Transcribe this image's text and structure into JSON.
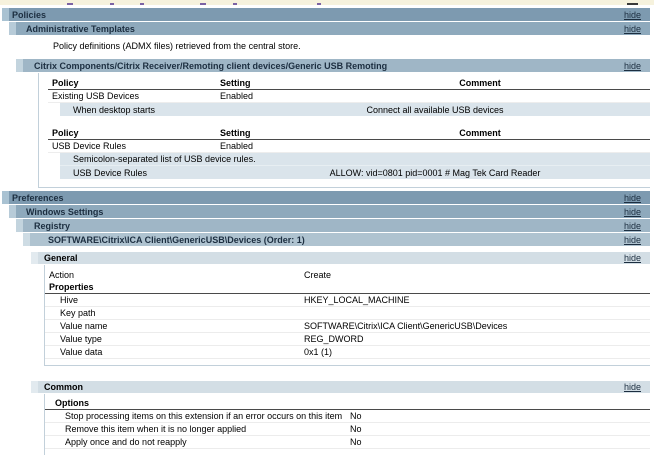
{
  "ui": {
    "hide_label": "hide"
  },
  "policies": {
    "title": "Policies",
    "administrative_templates": {
      "title": "Administrative Templates",
      "note": "Policy definitions (ADMX files) retrieved from the central store.",
      "generic_usb_remoting": {
        "title": "Citrix Components/Citrix Receiver/Remoting client devices/Generic USB Remoting",
        "columns": {
          "policy": "Policy",
          "setting": "Setting",
          "comment": "Comment"
        },
        "existing_usb_devices": {
          "policy": "Existing USB Devices",
          "setting": "Enabled",
          "comment": "",
          "option_label": "When desktop starts",
          "option_value": "Connect all available USB devices"
        },
        "usb_device_rules": {
          "policy": "USB Device Rules",
          "setting": "Enabled",
          "comment": "",
          "description": "Semicolon-separated list of USB device rules.",
          "option_label": "USB Device Rules",
          "option_value": "ALLOW: vid=0801 pid=0001 # Mag Tek Card Reader"
        }
      }
    }
  },
  "preferences": {
    "title": "Preferences",
    "windows_settings": {
      "title": "Windows Settings",
      "registry": {
        "title": "Registry",
        "item": {
          "title": "SOFTWARE\\Citrix\\ICA Client\\GenericUSB\\Devices (Order: 1)",
          "general": {
            "title": "General",
            "action": {
              "label": "Action",
              "value": "Create"
            },
            "properties_label": "Properties",
            "rows": [
              {
                "label": "Hive",
                "value": "HKEY_LOCAL_MACHINE"
              },
              {
                "label": "Key path",
                "value": ""
              },
              {
                "label": "Value name",
                "value": "SOFTWARE\\Citrix\\ICA Client\\GenericUSB\\Devices"
              },
              {
                "label": "Value type",
                "value": "REG_DWORD"
              },
              {
                "label": "Value data",
                "value": "0x1 (1)"
              }
            ]
          },
          "common": {
            "title": "Common",
            "options_label": "Options",
            "rows": [
              {
                "label": "Stop processing items on this extension if an error occurs on this item",
                "value": "No"
              },
              {
                "label": "Remove this item when it is no longer applied",
                "value": "No"
              },
              {
                "label": "Apply once and do not reapply",
                "value": "No"
              }
            ]
          }
        }
      }
    }
  },
  "colors": {
    "level0_bar": "#7D9AB0",
    "level1_bar": "#8EA9BC",
    "level2_bar": "#9FB6C6",
    "level3_bar": "#AFC3D0",
    "subsection_bar": "#D3DEE5",
    "option_row_bg": "#DAE4EB",
    "top_strip_bg": "#F6F2DD"
  }
}
